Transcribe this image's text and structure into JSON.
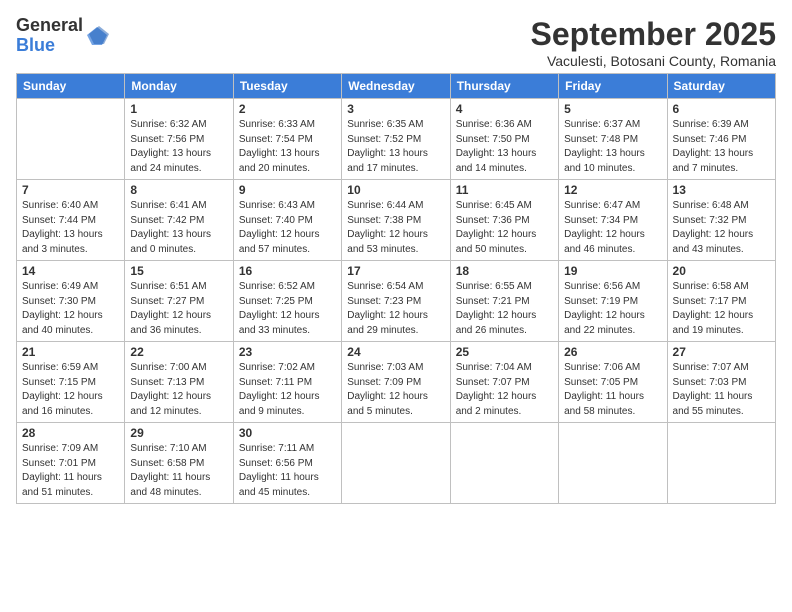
{
  "logo": {
    "general": "General",
    "blue": "Blue"
  },
  "header": {
    "month": "September 2025",
    "location": "Vaculesti, Botosani County, Romania"
  },
  "weekdays": [
    "Sunday",
    "Monday",
    "Tuesday",
    "Wednesday",
    "Thursday",
    "Friday",
    "Saturday"
  ],
  "weeks": [
    [
      {
        "day": "",
        "info": ""
      },
      {
        "day": "1",
        "info": "Sunrise: 6:32 AM\nSunset: 7:56 PM\nDaylight: 13 hours\nand 24 minutes."
      },
      {
        "day": "2",
        "info": "Sunrise: 6:33 AM\nSunset: 7:54 PM\nDaylight: 13 hours\nand 20 minutes."
      },
      {
        "day": "3",
        "info": "Sunrise: 6:35 AM\nSunset: 7:52 PM\nDaylight: 13 hours\nand 17 minutes."
      },
      {
        "day": "4",
        "info": "Sunrise: 6:36 AM\nSunset: 7:50 PM\nDaylight: 13 hours\nand 14 minutes."
      },
      {
        "day": "5",
        "info": "Sunrise: 6:37 AM\nSunset: 7:48 PM\nDaylight: 13 hours\nand 10 minutes."
      },
      {
        "day": "6",
        "info": "Sunrise: 6:39 AM\nSunset: 7:46 PM\nDaylight: 13 hours\nand 7 minutes."
      }
    ],
    [
      {
        "day": "7",
        "info": "Sunrise: 6:40 AM\nSunset: 7:44 PM\nDaylight: 13 hours\nand 3 minutes."
      },
      {
        "day": "8",
        "info": "Sunrise: 6:41 AM\nSunset: 7:42 PM\nDaylight: 13 hours\nand 0 minutes."
      },
      {
        "day": "9",
        "info": "Sunrise: 6:43 AM\nSunset: 7:40 PM\nDaylight: 12 hours\nand 57 minutes."
      },
      {
        "day": "10",
        "info": "Sunrise: 6:44 AM\nSunset: 7:38 PM\nDaylight: 12 hours\nand 53 minutes."
      },
      {
        "day": "11",
        "info": "Sunrise: 6:45 AM\nSunset: 7:36 PM\nDaylight: 12 hours\nand 50 minutes."
      },
      {
        "day": "12",
        "info": "Sunrise: 6:47 AM\nSunset: 7:34 PM\nDaylight: 12 hours\nand 46 minutes."
      },
      {
        "day": "13",
        "info": "Sunrise: 6:48 AM\nSunset: 7:32 PM\nDaylight: 12 hours\nand 43 minutes."
      }
    ],
    [
      {
        "day": "14",
        "info": "Sunrise: 6:49 AM\nSunset: 7:30 PM\nDaylight: 12 hours\nand 40 minutes."
      },
      {
        "day": "15",
        "info": "Sunrise: 6:51 AM\nSunset: 7:27 PM\nDaylight: 12 hours\nand 36 minutes."
      },
      {
        "day": "16",
        "info": "Sunrise: 6:52 AM\nSunset: 7:25 PM\nDaylight: 12 hours\nand 33 minutes."
      },
      {
        "day": "17",
        "info": "Sunrise: 6:54 AM\nSunset: 7:23 PM\nDaylight: 12 hours\nand 29 minutes."
      },
      {
        "day": "18",
        "info": "Sunrise: 6:55 AM\nSunset: 7:21 PM\nDaylight: 12 hours\nand 26 minutes."
      },
      {
        "day": "19",
        "info": "Sunrise: 6:56 AM\nSunset: 7:19 PM\nDaylight: 12 hours\nand 22 minutes."
      },
      {
        "day": "20",
        "info": "Sunrise: 6:58 AM\nSunset: 7:17 PM\nDaylight: 12 hours\nand 19 minutes."
      }
    ],
    [
      {
        "day": "21",
        "info": "Sunrise: 6:59 AM\nSunset: 7:15 PM\nDaylight: 12 hours\nand 16 minutes."
      },
      {
        "day": "22",
        "info": "Sunrise: 7:00 AM\nSunset: 7:13 PM\nDaylight: 12 hours\nand 12 minutes."
      },
      {
        "day": "23",
        "info": "Sunrise: 7:02 AM\nSunset: 7:11 PM\nDaylight: 12 hours\nand 9 minutes."
      },
      {
        "day": "24",
        "info": "Sunrise: 7:03 AM\nSunset: 7:09 PM\nDaylight: 12 hours\nand 5 minutes."
      },
      {
        "day": "25",
        "info": "Sunrise: 7:04 AM\nSunset: 7:07 PM\nDaylight: 12 hours\nand 2 minutes."
      },
      {
        "day": "26",
        "info": "Sunrise: 7:06 AM\nSunset: 7:05 PM\nDaylight: 11 hours\nand 58 minutes."
      },
      {
        "day": "27",
        "info": "Sunrise: 7:07 AM\nSunset: 7:03 PM\nDaylight: 11 hours\nand 55 minutes."
      }
    ],
    [
      {
        "day": "28",
        "info": "Sunrise: 7:09 AM\nSunset: 7:01 PM\nDaylight: 11 hours\nand 51 minutes."
      },
      {
        "day": "29",
        "info": "Sunrise: 7:10 AM\nSunset: 6:58 PM\nDaylight: 11 hours\nand 48 minutes."
      },
      {
        "day": "30",
        "info": "Sunrise: 7:11 AM\nSunset: 6:56 PM\nDaylight: 11 hours\nand 45 minutes."
      },
      {
        "day": "",
        "info": ""
      },
      {
        "day": "",
        "info": ""
      },
      {
        "day": "",
        "info": ""
      },
      {
        "day": "",
        "info": ""
      }
    ]
  ]
}
